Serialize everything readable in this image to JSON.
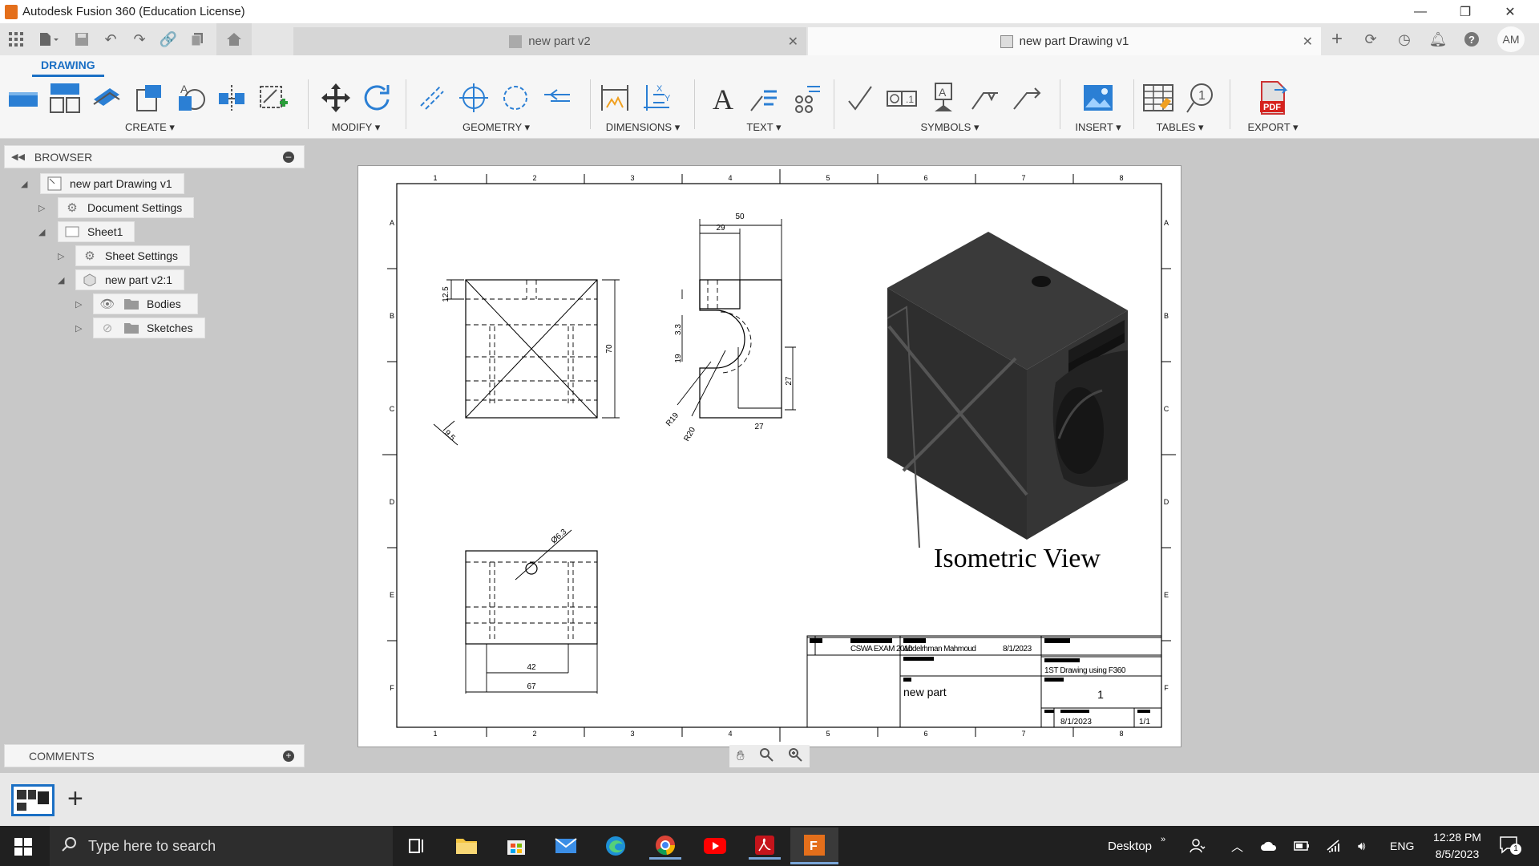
{
  "window": {
    "title": "Autodesk Fusion 360 (Education License)"
  },
  "tabs": [
    {
      "label": "new part v2"
    },
    {
      "label": "new part Drawing v1"
    }
  ],
  "user_initials": "AM",
  "ribbon": {
    "active_tab": "DRAWING",
    "groups": [
      "CREATE ▾",
      "MODIFY ▾",
      "GEOMETRY ▾",
      "DIMENSIONS ▾",
      "TEXT ▾",
      "SYMBOLS ▾",
      "INSERT ▾",
      "TABLES ▾",
      "EXPORT ▾"
    ],
    "pdf_label": "PDF"
  },
  "browser": {
    "title": "BROWSER",
    "items": [
      {
        "label": "new part Drawing v1"
      },
      {
        "label": "Document Settings"
      },
      {
        "label": "Sheet1"
      },
      {
        "label": "Sheet Settings"
      },
      {
        "label": "new part v2:1"
      },
      {
        "label": "Bodies"
      },
      {
        "label": "Sketches"
      }
    ]
  },
  "comments": {
    "title": "COMMENTS"
  },
  "drawing": {
    "zone_cols": [
      "1",
      "2",
      "3",
      "4",
      "5",
      "6",
      "7",
      "8"
    ],
    "zone_rows": [
      "A",
      "B",
      "C",
      "D",
      "E",
      "F"
    ],
    "dims": {
      "d12_5": "12.5",
      "d70": "70",
      "d9_5": "9.5",
      "d50": "50",
      "d29": "29",
      "d3_3": "3.3",
      "d19": "19",
      "d27v": "27",
      "d27h": "27",
      "r19": "R19",
      "r20": "R20",
      "dia": "Ø6.3",
      "d42": "42",
      "d67": "67"
    },
    "iso_caption": "Isometric View",
    "title_block": {
      "exam": "CSWA EXAM 2010",
      "author": "Abdelrhman Mahmoud",
      "author_date": "8/1/2023",
      "drawing_title": "1ST Drawing using F360",
      "part_name": "new part",
      "sheet_number": "1",
      "date": "8/1/2023",
      "sheet_count": "1/1"
    }
  },
  "taskbar": {
    "search_placeholder": "Type here to search",
    "desktop_label": "Desktop",
    "lang": "ENG",
    "time": "12:28 PM",
    "date": "8/5/2023",
    "notif_count": "1"
  },
  "colors": {
    "accent": "#1a6fc4",
    "app_orange": "#e46f1b",
    "taskbar": "#202020"
  }
}
